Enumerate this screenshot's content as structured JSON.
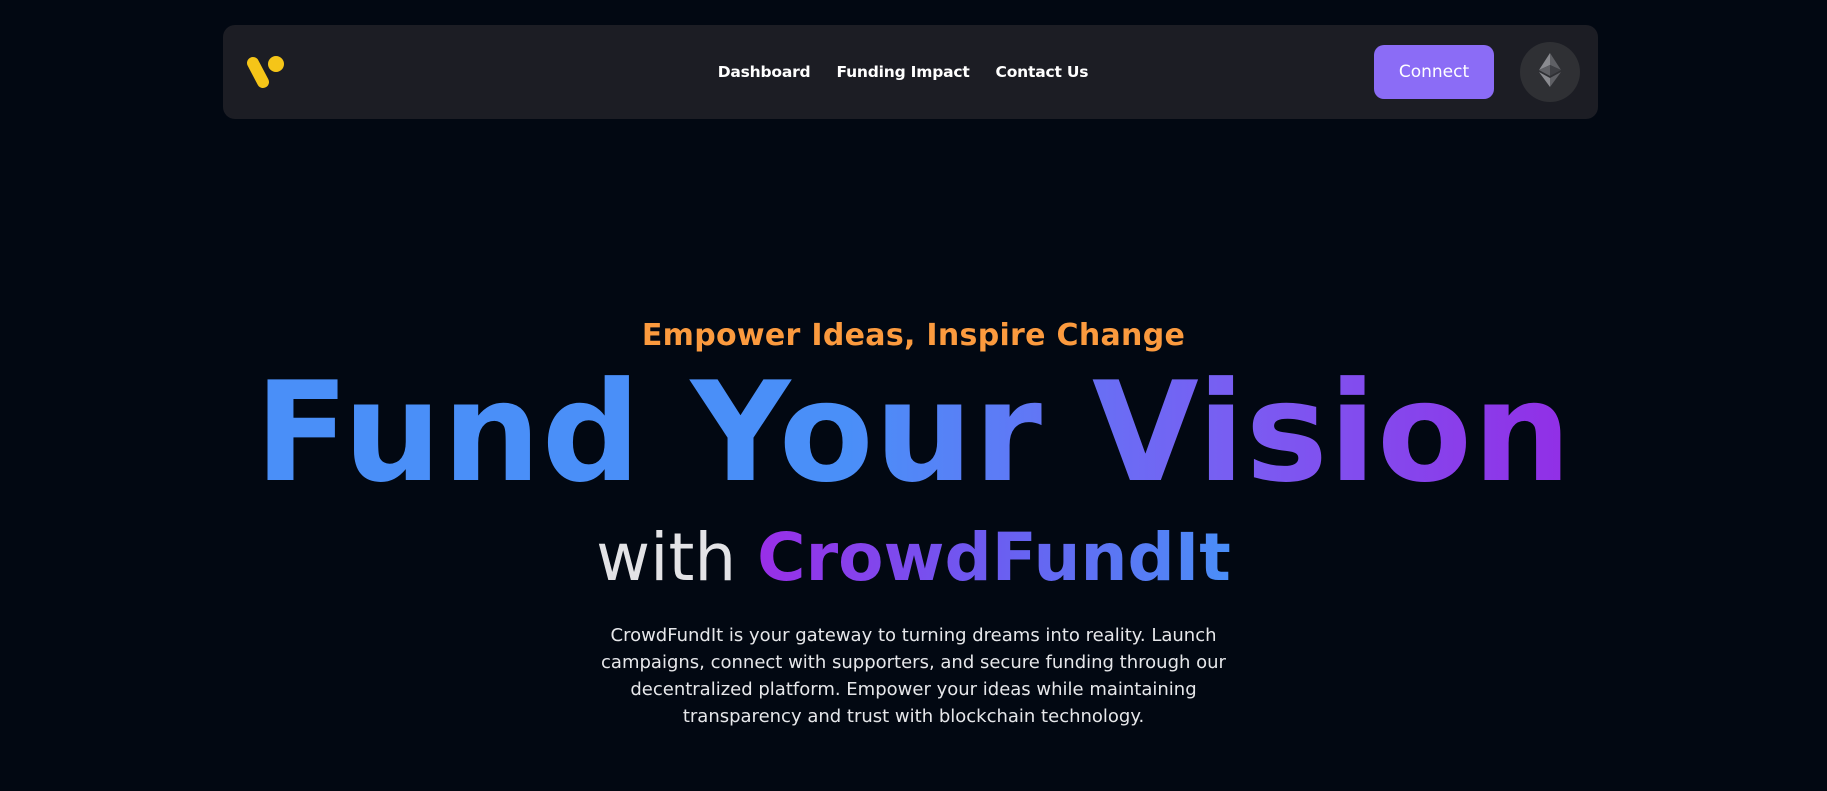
{
  "nav": {
    "logo_icon": "brand-logo-icon",
    "links": [
      {
        "label": "Dashboard"
      },
      {
        "label": "Funding Impact"
      },
      {
        "label": "Contact Us"
      }
    ],
    "connect_label": "Connect",
    "network_icon": "ethereum-icon"
  },
  "hero": {
    "tagline": "Empower Ideas, Inspire Change",
    "headline": "Fund Your Vision",
    "sub_prefix": "with",
    "brand": "CrowdFundIt",
    "description": "CrowdFundIt is your gateway to turning dreams into reality. Launch campaigns, connect with supporters, and secure funding through our decentralized platform. Empower your ideas while maintaining transparency and trust with blockchain technology."
  },
  "colors": {
    "background": "#020812",
    "navbar": "#1c1d24",
    "accent_button": "#8b6cf6",
    "tagline": "#fb9a3e",
    "gradient_blue": "#4a8ff8",
    "gradient_purple": "#922ee6",
    "logo_yellow": "#f5c518"
  }
}
